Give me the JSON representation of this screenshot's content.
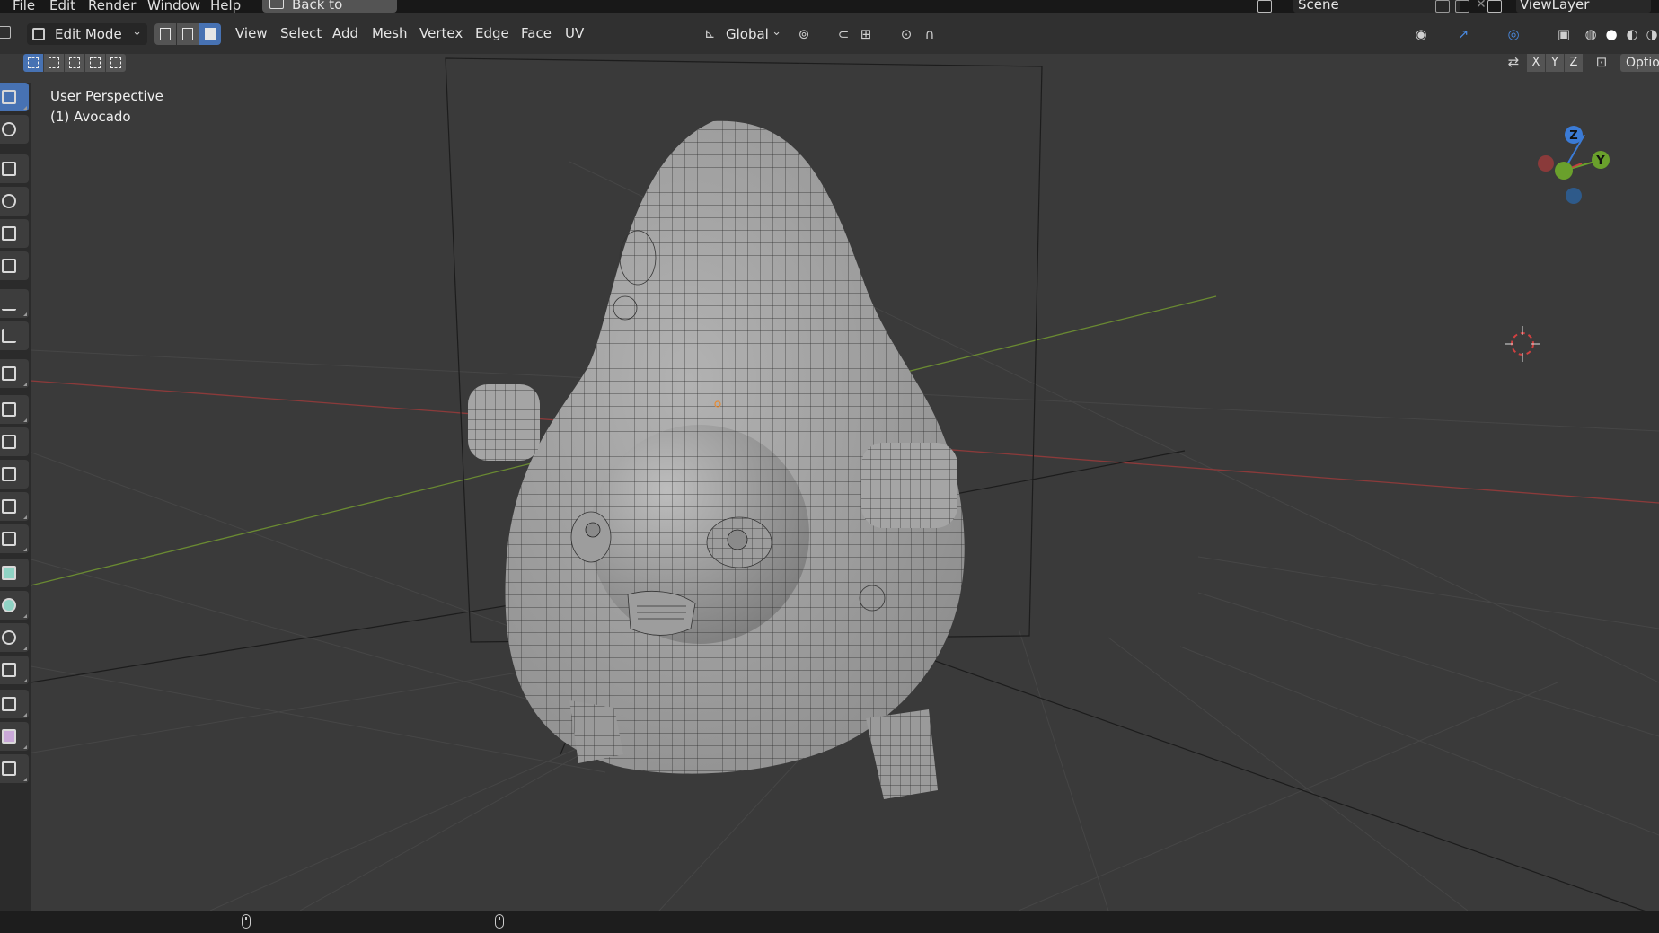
{
  "topbar": {
    "menus": [
      "File",
      "Edit",
      "Render",
      "Window",
      "Help"
    ],
    "back_button": "Back to Previous",
    "scene": "Scene",
    "view_layer": "ViewLayer"
  },
  "header": {
    "mode": "Edit Mode",
    "menus": [
      "View",
      "Select",
      "Add",
      "Mesh",
      "Vertex",
      "Edge",
      "Face",
      "UV"
    ],
    "orientation": "Global",
    "axes": [
      "X",
      "Y",
      "Z"
    ],
    "options": "Optio"
  },
  "viewport": {
    "view_name": "User Perspective",
    "object_name": "(1) Avocado",
    "gizmo_axes": [
      "Z",
      "Y"
    ],
    "colors": {
      "background": "#3a3a3a",
      "grid": "#464646",
      "x_axis": "#8c3a3a",
      "y_axis": "#6a8a32",
      "mesh": "#a3a3a3",
      "wire": "#202020",
      "accent": "#4772b3"
    }
  },
  "toolbar": {
    "tools": [
      "select-box",
      "cursor",
      "move",
      "rotate",
      "scale",
      "transform",
      "annotate",
      "measure",
      "add-cube",
      "extrude",
      "inset",
      "bevel",
      "loop-cut",
      "knife",
      "poly-build",
      "spin",
      "smooth",
      "edge-slide",
      "shrink-fatten",
      "shear",
      "rip"
    ]
  }
}
